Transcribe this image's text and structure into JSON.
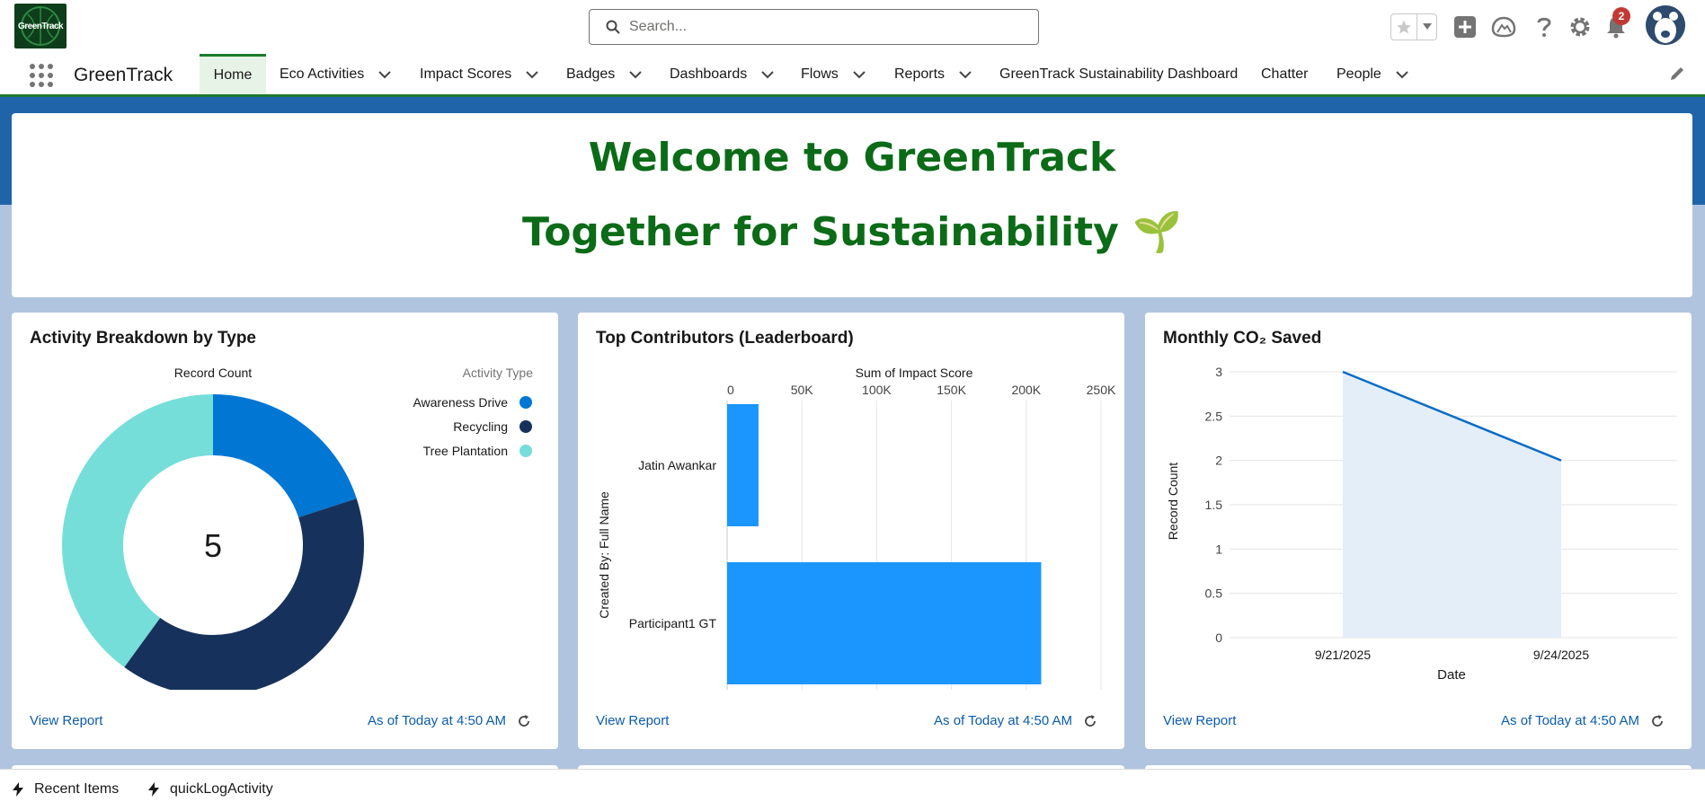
{
  "app": {
    "logo_text": "GreenTrack",
    "name": "GreenTrack"
  },
  "header": {
    "search_placeholder": "Search...",
    "notification_count": "2",
    "icons": [
      "star-icon",
      "add-icon",
      "trailhead-icon",
      "help-icon",
      "setup-gear-icon",
      "bell-icon",
      "avatar"
    ]
  },
  "nav": {
    "items": [
      {
        "label": "Home",
        "active": true,
        "has_menu": false
      },
      {
        "label": "Eco Activities",
        "has_menu": true
      },
      {
        "label": "Impact Scores",
        "has_menu": true
      },
      {
        "label": "Badges",
        "has_menu": true
      },
      {
        "label": "Dashboards",
        "has_menu": true
      },
      {
        "label": "Flows",
        "has_menu": true
      },
      {
        "label": "Reports",
        "has_menu": true
      },
      {
        "label": "GreenTrack Sustainability Dashboard",
        "has_menu": false
      },
      {
        "label": "Chatter",
        "has_menu": false
      },
      {
        "label": "People",
        "has_menu": true
      }
    ]
  },
  "welcome": {
    "line1": "Welcome to GreenTrack",
    "line2": "Together for Sustainability 🌱"
  },
  "cards": [
    {
      "title": "Activity Breakdown by Type",
      "view_report": "View Report",
      "timestamp": "As of Today at 4:50 AM",
      "chart_data": {
        "type": "donut",
        "title": "Record Count",
        "legend_title": "Activity Type",
        "legend_position": "top-right",
        "center_label": "5",
        "slices": [
          {
            "name": "Awareness Drive",
            "value": 1,
            "color": "#0176d3"
          },
          {
            "name": "Recycling",
            "value": 2,
            "color": "#16325c"
          },
          {
            "name": "Tree Plantation",
            "value": 2,
            "color": "#76ded9"
          }
        ]
      }
    },
    {
      "title": "Top Contributors (Leaderboard)",
      "view_report": "View Report",
      "timestamp": "As of Today at 4:50 AM",
      "chart_data": {
        "type": "bar",
        "orientation": "horizontal",
        "title": "Sum of Impact Score",
        "ylabel": "Created By: Full Name",
        "categories": [
          "Jatin Awankar",
          "Participant1 GT"
        ],
        "values": [
          21000,
          210000
        ],
        "xlim": [
          0,
          250000
        ],
        "xticks": [
          "0",
          "50K",
          "100K",
          "150K",
          "200K",
          "250K"
        ],
        "color": "#1b96ff",
        "grid": true
      }
    },
    {
      "title": "Monthly CO₂ Saved",
      "view_report": "View Report",
      "timestamp": "As of Today at 4:50 AM",
      "chart_data": {
        "type": "area",
        "xlabel": "Date",
        "ylabel": "Record Count",
        "x": [
          "9/21/2025",
          "9/24/2025"
        ],
        "y": [
          3,
          2
        ],
        "ylim": [
          0,
          3
        ],
        "yticks": [
          "0",
          "0.5",
          "1",
          "1.5",
          "2",
          "2.5",
          "3"
        ],
        "line_color": "#0b6cc4",
        "fill_color": "#e3eef9",
        "grid": true
      }
    }
  ],
  "utility": {
    "items": [
      {
        "label": "Recent Items"
      },
      {
        "label": "quickLogActivity"
      }
    ]
  }
}
